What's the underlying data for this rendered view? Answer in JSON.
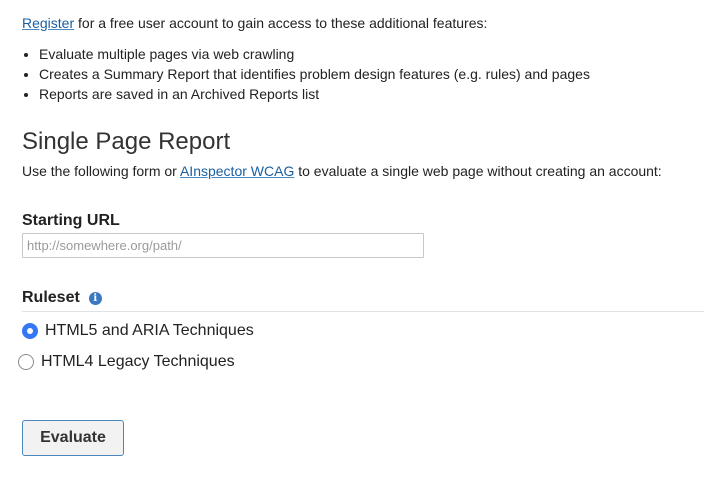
{
  "intro": {
    "register_link": "Register",
    "text": " for a free user account to gain access to these additional features:"
  },
  "features": [
    "Evaluate multiple pages via web crawling",
    "Creates a Summary Report that identifies problem design features (e.g. rules) and pages",
    "Reports are saved in an Archived Reports list"
  ],
  "section": {
    "title": "Single Page Report",
    "desc_before": "Use the following form or ",
    "desc_link": "AInspector WCAG",
    "desc_after": " to evaluate a single web page without creating an account:"
  },
  "form": {
    "url_label": "Starting URL",
    "url_placeholder": "http://somewhere.org/path/",
    "url_value": "",
    "ruleset_label": "Ruleset",
    "rulesets": [
      {
        "label": "HTML5 and ARIA Techniques",
        "selected": true
      },
      {
        "label": "HTML4 Legacy Techniques",
        "selected": false
      }
    ],
    "submit_label": "Evaluate"
  },
  "colors": {
    "link": "#1a5fa0",
    "radio_selected": "#3478f6",
    "info_icon": "#3b78c2",
    "button_border": "#4a86c0"
  }
}
